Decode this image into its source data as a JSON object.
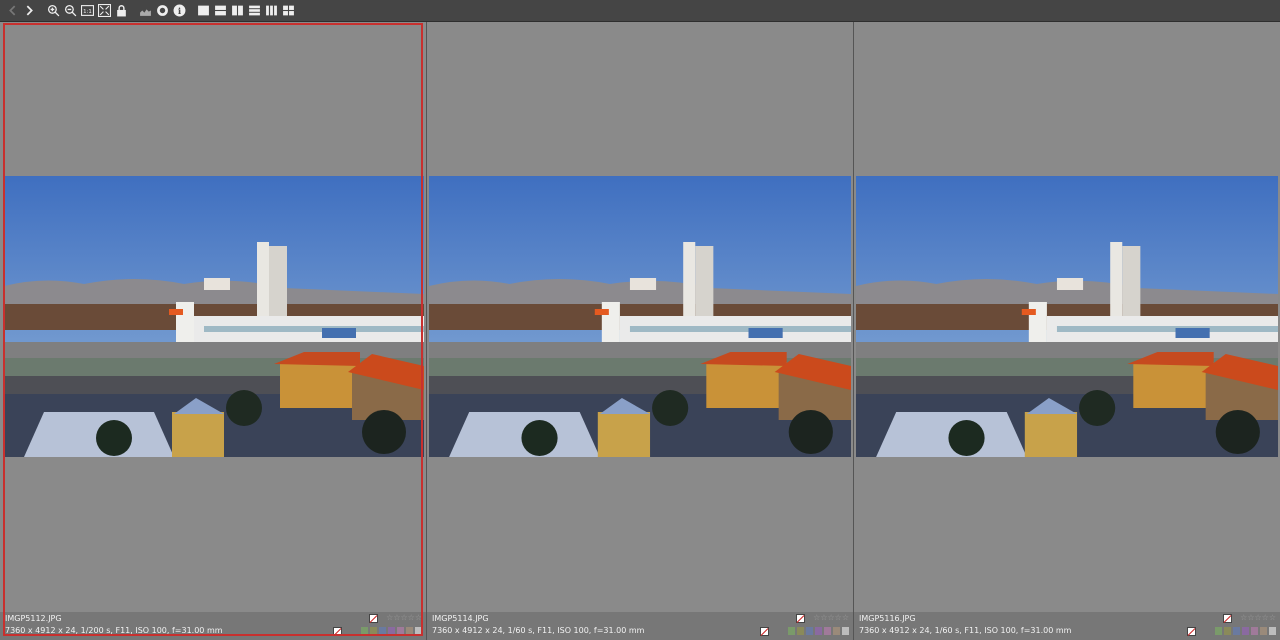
{
  "toolbar": {
    "buttons": [
      {
        "name": "back-icon",
        "glyph": "‹"
      },
      {
        "name": "forward-icon",
        "glyph": "›"
      },
      {
        "name": "zoom-in-icon"
      },
      {
        "name": "zoom-out-icon"
      },
      {
        "name": "actual-size-icon",
        "label": "1:1"
      },
      {
        "name": "fit-to-screen-icon"
      },
      {
        "name": "lock-icon"
      },
      {
        "name": "histogram-icon"
      },
      {
        "name": "color-target-icon"
      },
      {
        "name": "info-icon",
        "label": "i"
      },
      {
        "name": "layout-single-icon"
      },
      {
        "name": "layout-two-horizontal-icon"
      },
      {
        "name": "layout-two-vertical-icon"
      },
      {
        "name": "layout-three-horizontal-icon"
      },
      {
        "name": "layout-three-vertical-icon"
      },
      {
        "name": "layout-four-icon"
      }
    ]
  },
  "panels": [
    {
      "filename": "IMGP5112.JPG",
      "exif": "7360 x 4912 x 24, 1/200 s, F11, ISO 100, f=31.00 mm",
      "selected": true
    },
    {
      "filename": "IMGP5114.JPG",
      "exif": "7360 x 4912 x 24, 1/60 s, F11, ISO 100, f=31.00 mm",
      "selected": false
    },
    {
      "filename": "IMGP5116.JPG",
      "exif": "7360 x 4912 x 24, 1/60 s, F11, ISO 100, f=31.00 mm",
      "selected": false
    }
  ],
  "rating_stars": "☆☆☆☆☆",
  "color_labels": [
    "#7a9a6a",
    "#8a8a5a",
    "#6a7aa0",
    "#8a6aa0",
    "#a07a9a",
    "#9a8a7a",
    "#bdbdbd"
  ],
  "colors": {
    "selection_border": "#c8302e",
    "background": "#8a8a8a",
    "toolbar": "#454545"
  }
}
